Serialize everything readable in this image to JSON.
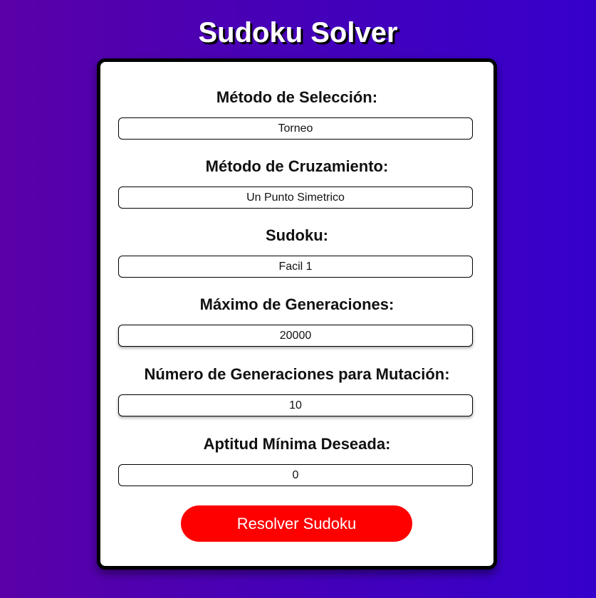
{
  "page": {
    "title": "Sudoku Solver",
    "accent_color": "#ff0000",
    "background_colors": [
      "#5a00a8",
      "#3600cc"
    ]
  },
  "form": {
    "selection_method": {
      "label": "Método de Selección:",
      "value": "Torneo"
    },
    "crossover_method": {
      "label": "Método de Cruzamiento:",
      "value": "Un Punto Simetrico"
    },
    "sudoku": {
      "label": "Sudoku:",
      "value": "Facil 1"
    },
    "max_generations": {
      "label": "Máximo de Generaciones:",
      "value": "20000"
    },
    "mutation_generations": {
      "label": "Número de Generaciones para Mutación:",
      "value": "10"
    },
    "min_fitness": {
      "label": "Aptitud Mínima Deseada:",
      "value": "0"
    },
    "submit_label": "Resolver Sudoku"
  }
}
